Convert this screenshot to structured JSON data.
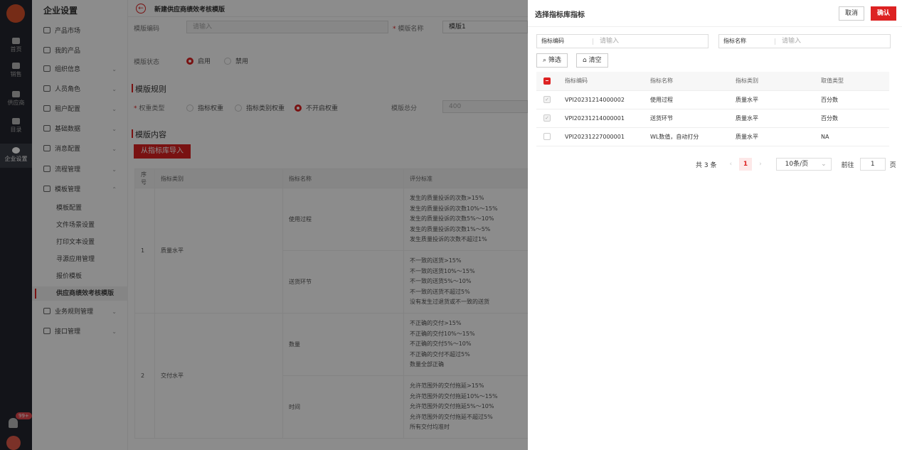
{
  "rail": {
    "items": [
      "首页",
      "销售",
      "供应商",
      "目录",
      "企业设置"
    ],
    "badge": "99+"
  },
  "sidebar": {
    "title": "企业设置",
    "menus": [
      {
        "label": "产品市场",
        "icon": "calendar-icon",
        "chevron": false
      },
      {
        "label": "我的产品",
        "icon": "cube-icon",
        "chevron": false
      },
      {
        "label": "组织信息",
        "icon": "building-icon",
        "chevron": true
      },
      {
        "label": "人员角色",
        "icon": "users-icon",
        "chevron": true
      },
      {
        "label": "租户配置",
        "icon": "tenant-icon",
        "chevron": true
      },
      {
        "label": "基础数据",
        "icon": "data-icon",
        "chevron": true
      },
      {
        "label": "消息配置",
        "icon": "message-icon",
        "chevron": true
      },
      {
        "label": "流程管理",
        "icon": "flow-icon",
        "chevron": true
      },
      {
        "label": "模板管理",
        "icon": "template-icon",
        "chevron": true
      }
    ],
    "subs": [
      "模板配置",
      "文件场景设置",
      "打印文本设置",
      "寻源应用管理",
      "报价模板",
      "供应商绩效考核模版"
    ],
    "menus_after": [
      {
        "label": "业务规则管理",
        "icon": "rule-icon"
      },
      {
        "label": "接口管理",
        "icon": "api-icon"
      }
    ]
  },
  "page": {
    "title": "新建供应商绩效考核模版",
    "template_code_label": "模版编码",
    "template_code_placeholder": "请输入",
    "template_name_label": "模版名称",
    "template_name_value": "模版1",
    "status_label": "模版状态",
    "status_options": [
      "启用",
      "禁用"
    ],
    "rules_title": "模版规则",
    "weight_label": "权重类型",
    "weight_options": [
      "指标权重",
      "指标类别权重",
      "不开启权重"
    ],
    "total_label": "模版总分",
    "total_value": "400",
    "content_title": "模版内容",
    "import_button": "从指标库导入",
    "table": {
      "headers": [
        "序号",
        "指标类别",
        "指标名称",
        "评分标准"
      ],
      "groups": [
        {
          "no": "1",
          "category": "质量水平",
          "rows": [
            {
              "name": "使用过程",
              "criteria": [
                "发生的质量投诉的次数>15%",
                "发生的质量投诉的次数10%～15%",
                "发生的质量投诉的次数5%～10%",
                "发生的质量投诉的次数1%～5%",
                "发生质量投诉的次数不超过1%"
              ]
            },
            {
              "name": "送货环节",
              "criteria": [
                "不一致的送货>15%",
                "不一致的送货10%～15%",
                "不一致的送货5%～10%",
                "不一致的送货不超过5%",
                "没有发生过退货或不一致的送货"
              ]
            }
          ]
        },
        {
          "no": "2",
          "category": "交付水平",
          "rows": [
            {
              "name": "数量",
              "criteria": [
                "不正确的交付>15%",
                "不正确的交付10%～15%",
                "不正确的交付5%～10%",
                "不正确的交付不超过5%",
                "数量全部正确"
              ]
            },
            {
              "name": "时间",
              "criteria": [
                "允许范围外的交付拖延>15%",
                "允许范围外的交付拖延10%～15%",
                "允许范围外的交付拖延5%～10%",
                "允许范围外的交付拖延不超过5%",
                "所有交付均准时"
              ]
            }
          ]
        }
      ]
    }
  },
  "drawer": {
    "title": "选择指标库指标",
    "cancel": "取消",
    "confirm": "确认",
    "code_label": "指标编码",
    "code_placeholder": "请输入",
    "name_label": "指标名称",
    "name_placeholder": "请输入",
    "filter_button": "筛选",
    "clear_button": "清空",
    "headers": [
      "指标编码",
      "指标名称",
      "指标类别",
      "取值类型"
    ],
    "rows": [
      {
        "code": "VPI20231214000002",
        "name": "使用过程",
        "category": "质量水平",
        "type": "百分数",
        "checked": true
      },
      {
        "code": "VPI20231214000001",
        "name": "送货环节",
        "category": "质量水平",
        "type": "百分数",
        "checked": true
      },
      {
        "code": "VPI20231227000001",
        "name": "WL数值，自动打分",
        "category": "质量水平",
        "type": "NA",
        "checked": false
      }
    ],
    "pager": {
      "total": "共 3 条",
      "current": "1",
      "page_size": "10条/页",
      "goto_label": "前往",
      "goto_value": "1",
      "page_unit": "页"
    }
  },
  "colors": {
    "accent": "#dd2222",
    "rail": "#23262e"
  }
}
